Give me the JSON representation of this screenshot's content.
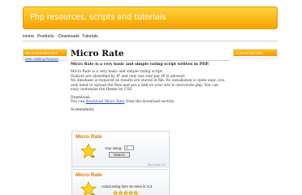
{
  "header": {
    "title": "Php resources, scripts and tutorials"
  },
  "nav": {
    "items": [
      "Home",
      "Products",
      "Downloads",
      "Tutorials"
    ]
  },
  "sidebar_left": {
    "heading": "Recommended sites",
    "link": "Web Hosting Reviews"
  },
  "sidebar_right": {
    "heading": "Commercial links"
  },
  "main": {
    "title": "Micro Rate",
    "intro": "Micro Rate is a very basic and simple rating script written in PHP.",
    "para1": [
      "Micro Rate is a very basic and simple rating script.",
      "Visitors are identified by IP and only one rate per IP is allowed.",
      "No database is required as results are stored in file. Its installation is quite easy: you",
      "only need to upload the files and put a link on your site to microrate.php. You can",
      "easy customize the theme by CSS."
    ],
    "download_label": "Download:",
    "download_prefix": "You can ",
    "download_link": "download Micro Rate",
    "download_suffix": " from the download section.",
    "screenshots_label": "Screenshots:"
  },
  "screenshot1": {
    "title": "Micro Rate",
    "rating_label": "Your rating:",
    "select_value": "4",
    "button": "Rate it!",
    "footer": "Micro Rate v1.0"
  },
  "screenshot2": {
    "title": "Micro Rate",
    "result_text": "Actual rating from 15 votes is: 5.3",
    "stars_filled": 5,
    "stars_total": 5
  },
  "colors": {
    "accent": "#f5a300",
    "link": "#1f3fa0",
    "shot_title": "#d87800"
  }
}
